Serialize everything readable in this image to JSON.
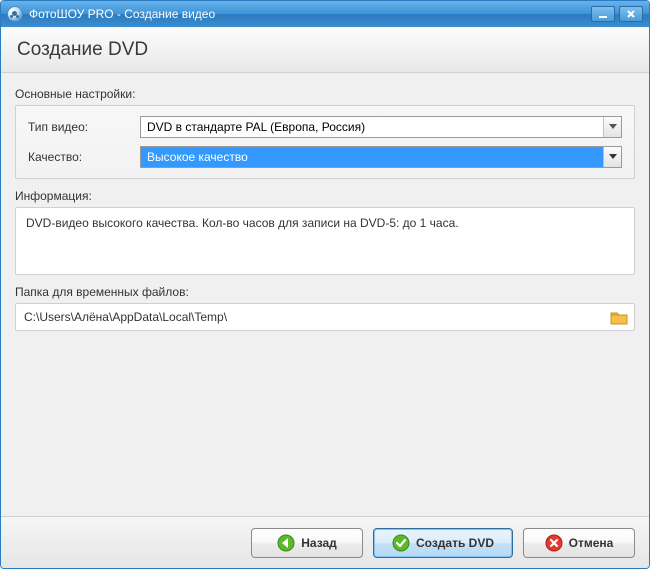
{
  "titlebar": {
    "app_title": "ФотоШОУ PRO - Создание видео"
  },
  "header": {
    "title": "Создание DVD"
  },
  "main_settings": {
    "group_label": "Основные настройки:",
    "video_type_label": "Тип видео:",
    "video_type_value": "DVD в стандарте PAL (Европа, Россия)",
    "quality_label": "Качество:",
    "quality_value": "Высокое качество"
  },
  "information": {
    "group_label": "Информация:",
    "text": "DVD-видео высокого качества. Кол-во часов для записи на DVD-5: до 1 часа."
  },
  "temp_folder": {
    "group_label": "Папка для временных файлов:",
    "path": "C:\\Users\\Алёна\\AppData\\Local\\Temp\\"
  },
  "footer": {
    "back_label": "Назад",
    "create_label": "Создать DVD",
    "cancel_label": "Отмена"
  }
}
